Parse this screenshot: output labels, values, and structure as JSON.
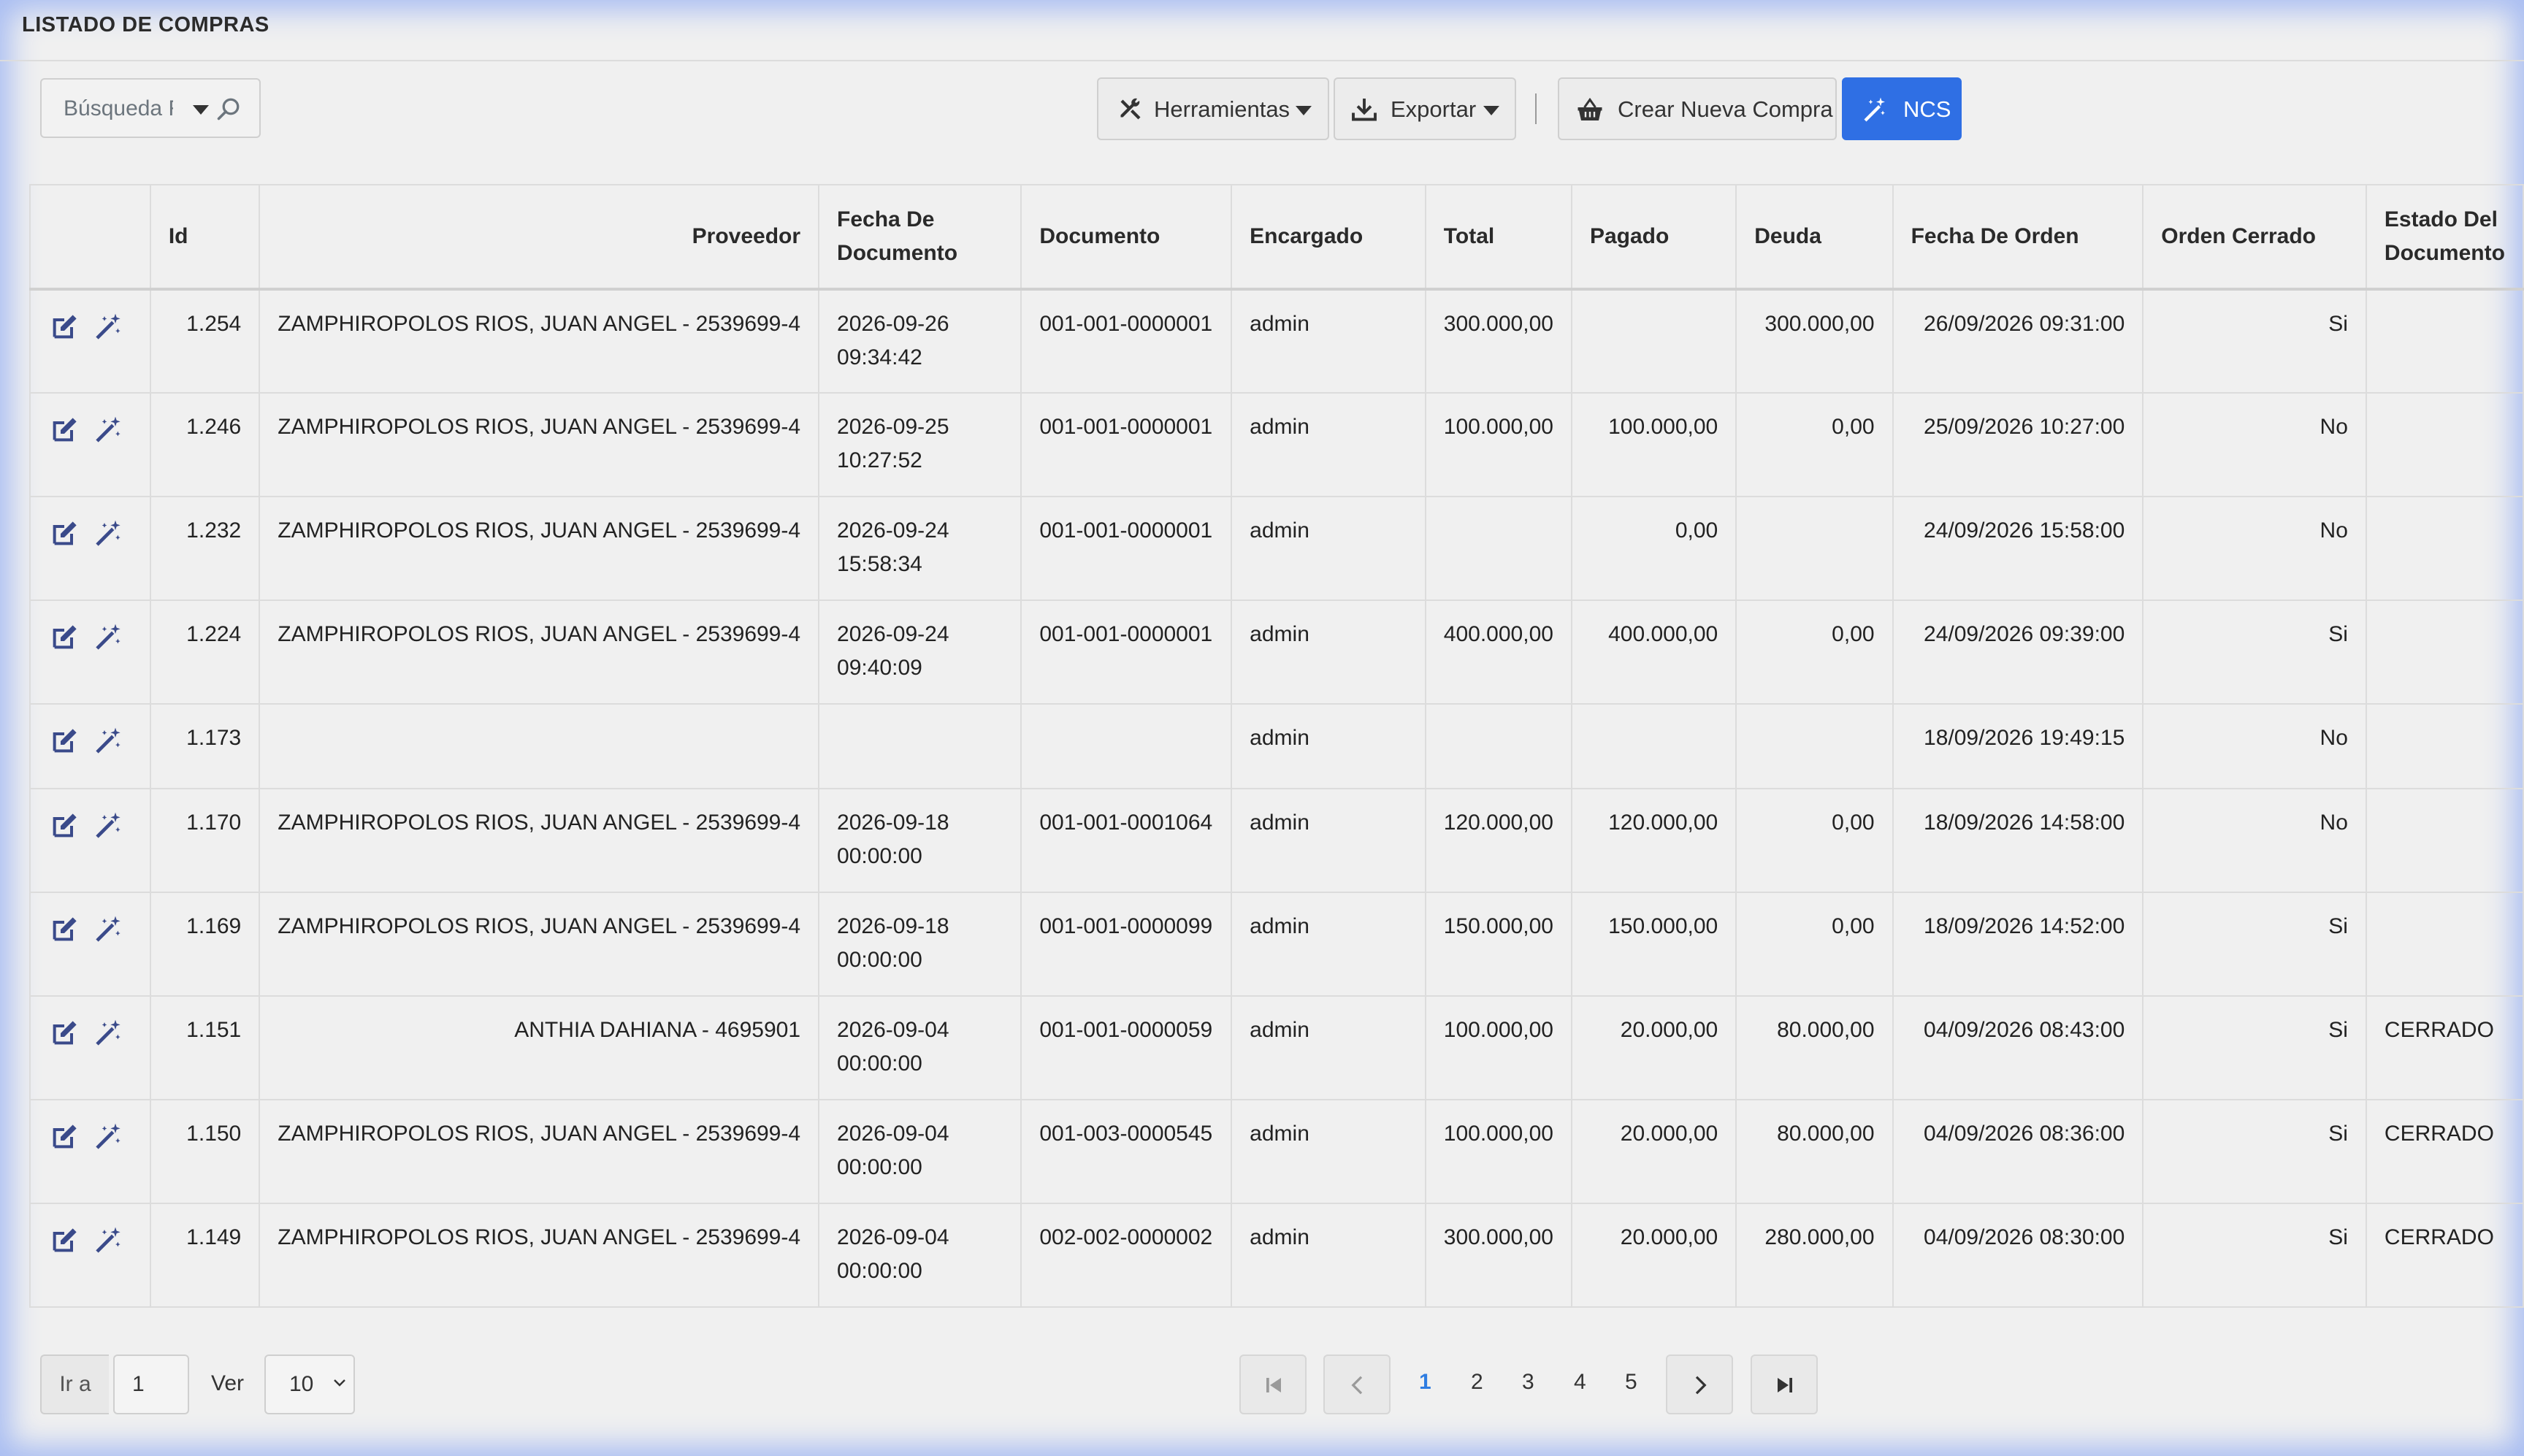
{
  "page": {
    "title": "LISTADO DE COMPRAS"
  },
  "search": {
    "placeholder": "Búsqueda Rápida"
  },
  "toolbar": {
    "tools_label": "Herramientas",
    "export_label": "Exportar",
    "new_label": "Crear Nueva Compra",
    "ncs_label": "NCS"
  },
  "table": {
    "headers": {
      "id": "Id",
      "proveedor": "Proveedor",
      "fecha_doc_1": "Fecha De",
      "fecha_doc_2": "Documento",
      "documento": "Documento",
      "encargado": "Encargado",
      "total": "Total",
      "pagado": "Pagado",
      "deuda": "Deuda",
      "fecha_orden": "Fecha De Orden",
      "orden_cerrado": "Orden Cerrado",
      "estado_1": "Estado Del",
      "estado_2": "Documento"
    },
    "rows": [
      {
        "id": "1.254",
        "proveedor": "ZAMPHIROPOLOS RIOS, JUAN ANGEL - 2539699-4",
        "fecha_d": "2026-09-26",
        "fecha_t": "09:34:42",
        "documento": "001-001-0000001",
        "encargado": "admin",
        "total": "300.000,00",
        "pagado": "",
        "deuda": "300.000,00",
        "fecha_orden": "26/09/2026 09:31:00",
        "cerrado": "Si",
        "estado": ""
      },
      {
        "id": "1.246",
        "proveedor": "ZAMPHIROPOLOS RIOS, JUAN ANGEL - 2539699-4",
        "fecha_d": "2026-09-25",
        "fecha_t": "10:27:52",
        "documento": "001-001-0000001",
        "encargado": "admin",
        "total": "100.000,00",
        "pagado": "100.000,00",
        "deuda": "0,00",
        "fecha_orden": "25/09/2026 10:27:00",
        "cerrado": "No",
        "estado": ""
      },
      {
        "id": "1.232",
        "proveedor": "ZAMPHIROPOLOS RIOS, JUAN ANGEL - 2539699-4",
        "fecha_d": "2026-09-24",
        "fecha_t": "15:58:34",
        "documento": "001-001-0000001",
        "encargado": "admin",
        "total": "",
        "pagado": "0,00",
        "deuda": "",
        "fecha_orden": "24/09/2026 15:58:00",
        "cerrado": "No",
        "estado": ""
      },
      {
        "id": "1.224",
        "proveedor": "ZAMPHIROPOLOS RIOS, JUAN ANGEL - 2539699-4",
        "fecha_d": "2026-09-24",
        "fecha_t": "09:40:09",
        "documento": "001-001-0000001",
        "encargado": "admin",
        "total": "400.000,00",
        "pagado": "400.000,00",
        "deuda": "0,00",
        "fecha_orden": "24/09/2026 09:39:00",
        "cerrado": "Si",
        "estado": ""
      },
      {
        "id": "1.173",
        "proveedor": "",
        "fecha_d": "",
        "fecha_t": "",
        "documento": "",
        "encargado": "admin",
        "total": "",
        "pagado": "",
        "deuda": "",
        "fecha_orden": "18/09/2026 19:49:15",
        "cerrado": "No",
        "estado": ""
      },
      {
        "id": "1.170",
        "proveedor": "ZAMPHIROPOLOS RIOS, JUAN ANGEL - 2539699-4",
        "fecha_d": "2026-09-18",
        "fecha_t": "00:00:00",
        "documento": "001-001-0001064",
        "encargado": "admin",
        "total": "120.000,00",
        "pagado": "120.000,00",
        "deuda": "0,00",
        "fecha_orden": "18/09/2026 14:58:00",
        "cerrado": "No",
        "estado": ""
      },
      {
        "id": "1.169",
        "proveedor": "ZAMPHIROPOLOS RIOS, JUAN ANGEL - 2539699-4",
        "fecha_d": "2026-09-18",
        "fecha_t": "00:00:00",
        "documento": "001-001-0000099",
        "encargado": "admin",
        "total": "150.000,00",
        "pagado": "150.000,00",
        "deuda": "0,00",
        "fecha_orden": "18/09/2026 14:52:00",
        "cerrado": "Si",
        "estado": ""
      },
      {
        "id": "1.151",
        "proveedor": "ANTHIA DAHIANA - 4695901",
        "fecha_d": "2026-09-04",
        "fecha_t": "00:00:00",
        "documento": "001-001-0000059",
        "encargado": "admin",
        "total": "100.000,00",
        "pagado": "20.000,00",
        "deuda": "80.000,00",
        "fecha_orden": "04/09/2026 08:43:00",
        "cerrado": "Si",
        "estado": "CERRADO"
      },
      {
        "id": "1.150",
        "proveedor": "ZAMPHIROPOLOS RIOS, JUAN ANGEL - 2539699-4",
        "fecha_d": "2026-09-04",
        "fecha_t": "00:00:00",
        "documento": "001-003-0000545",
        "encargado": "admin",
        "total": "100.000,00",
        "pagado": "20.000,00",
        "deuda": "80.000,00",
        "fecha_orden": "04/09/2026 08:36:00",
        "cerrado": "Si",
        "estado": "CERRADO"
      },
      {
        "id": "1.149",
        "proveedor": "ZAMPHIROPOLOS RIOS, JUAN ANGEL - 2539699-4",
        "fecha_d": "2026-09-04",
        "fecha_t": "00:00:00",
        "documento": "002-002-0000002",
        "encargado": "admin",
        "total": "300.000,00",
        "pagado": "20.000,00",
        "deuda": "280.000,00",
        "fecha_orden": "04/09/2026 08:30:00",
        "cerrado": "Si",
        "estado": "CERRADO"
      }
    ]
  },
  "footer": {
    "goto_label": "Ir a",
    "goto_value": "1",
    "ver_label": "Ver",
    "per_page": "10",
    "pages": [
      "1",
      "2",
      "3",
      "4",
      "5"
    ],
    "current_page": "1"
  },
  "icons": {
    "edit": "edit-icon",
    "magic": "magic-wand-icon",
    "search": "search-icon",
    "tools": "tools-icon",
    "export": "download-icon",
    "basket": "basket-icon"
  },
  "colors": {
    "accent": "#2f6fe4",
    "active_page": "#2f7de1",
    "row_icon": "#3a4a8a"
  }
}
